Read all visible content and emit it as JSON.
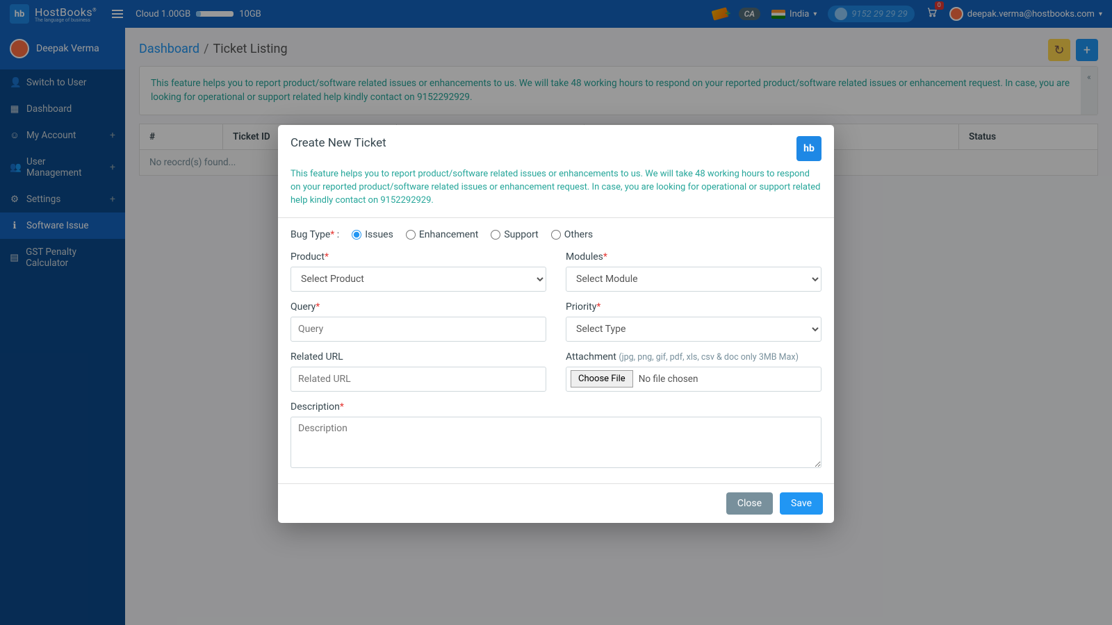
{
  "topbar": {
    "logo_abbrev": "hb",
    "logo_text": "HostBooks",
    "logo_sub": "The language of business",
    "cloud_used": "Cloud 1.00GB",
    "cloud_total": "10GB",
    "ca_badge": "CA",
    "country": "India",
    "phone": "9152 29 29 29",
    "cart_count": "0",
    "user_email": "deepak.verma@hostbooks.com"
  },
  "sidebar": {
    "user_name": "Deepak Verma",
    "items": [
      {
        "icon": "👤",
        "label": "Switch to User",
        "expandable": false
      },
      {
        "icon": "▦",
        "label": "Dashboard",
        "expandable": false
      },
      {
        "icon": "☺",
        "label": "My Account",
        "expandable": true
      },
      {
        "icon": "👥",
        "label": "User Management",
        "expandable": true
      },
      {
        "icon": "⚙",
        "label": "Settings",
        "expandable": true
      },
      {
        "icon": "ℹ",
        "label": "Software Issue",
        "expandable": false,
        "active": true
      },
      {
        "icon": "▤",
        "label": "GST Penalty Calculator",
        "expandable": false
      }
    ]
  },
  "breadcrumb": {
    "root": "Dashboard",
    "current": "Ticket Listing"
  },
  "banner": "This feature helps you to report product/software related issues or enhancements to us. We will take 48 working hours to respond on your reported product/software related issues or enhancement request. In case, you are looking for operational or support related help kindly contact on 9152292929.",
  "table": {
    "headers": [
      "#",
      "Ticket ID",
      "",
      "",
      "",
      "Status"
    ],
    "empty": "No reocrd(s) found..."
  },
  "modal": {
    "title": "Create New Ticket",
    "logo": "hb",
    "info": "This feature helps you to report product/software related issues or enhancements to us. We will take 48 working hours to respond on your reported product/software related issues or enhancement request. In case, you are looking for operational or support related help kindly contact on 9152292929.",
    "bug_type_label": "Bug Type",
    "bug_types": [
      "Issues",
      "Enhancement",
      "Support",
      "Others"
    ],
    "labels": {
      "product": "Product",
      "modules": "Modules",
      "query": "Query",
      "priority": "Priority",
      "related_url": "Related URL",
      "attachment": "Attachment",
      "attachment_hint": "(jpg, png, gif, pdf, xls, csv & doc only 3MB Max)",
      "description": "Description"
    },
    "placeholders": {
      "product": "Select Product",
      "modules": "Select Module",
      "query": "Query",
      "priority": "Select Type",
      "related_url": "Related URL",
      "file_btn": "Choose File",
      "file_none": "No file chosen",
      "description": "Description"
    },
    "buttons": {
      "close": "Close",
      "save": "Save"
    }
  }
}
